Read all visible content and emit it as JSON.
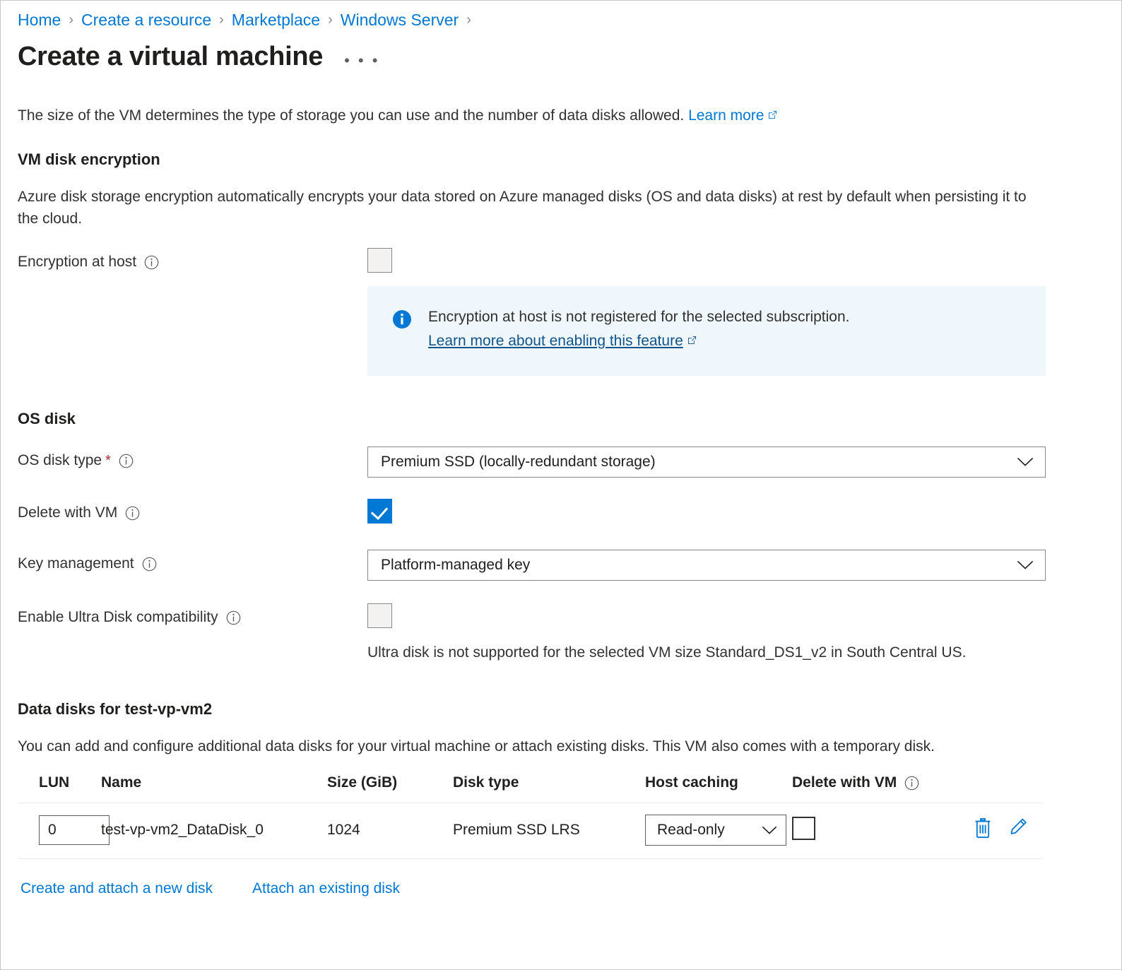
{
  "breadcrumb": {
    "items": [
      {
        "label": "Home"
      },
      {
        "label": "Create a resource"
      },
      {
        "label": "Marketplace"
      },
      {
        "label": "Windows Server"
      }
    ],
    "separator": "›"
  },
  "header": {
    "title": "Create a virtual machine",
    "more_label": "• • •"
  },
  "intro": {
    "text": "The size of the VM determines the type of storage you can use and the number of data disks allowed.",
    "link_label": "Learn more"
  },
  "vm_disk_encryption": {
    "heading": "VM disk encryption",
    "description": "Azure disk storage encryption automatically encrypts your data stored on Azure managed disks (OS and data disks) at rest by default when persisting it to the cloud.",
    "encryption_at_host": {
      "label": "Encryption at host",
      "checked": false
    },
    "banner": {
      "message": "Encryption at host is not registered for the selected subscription.",
      "link_label": "Learn more about enabling this feature",
      "background": "#eff6fc",
      "icon_color": "#0078d4"
    }
  },
  "os_disk": {
    "heading": "OS disk",
    "disk_type": {
      "label": "OS disk type",
      "required_marker": "*",
      "value": "Premium SSD (locally-redundant storage)"
    },
    "delete_with_vm": {
      "label": "Delete with VM",
      "checked": true
    },
    "key_management": {
      "label": "Key management",
      "value": "Platform-managed key"
    },
    "ultra_disk": {
      "label": "Enable Ultra Disk compatibility",
      "checked": false,
      "note": "Ultra disk is not supported for the selected VM size Standard_DS1_v2 in South Central US."
    }
  },
  "data_disks": {
    "heading": "Data disks for test-vp-vm2",
    "description": "You can add and configure additional data disks for your virtual machine or attach existing disks. This VM also comes with a temporary disk.",
    "columns": {
      "lun": "LUN",
      "name": "Name",
      "size": "Size (GiB)",
      "disk_type": "Disk type",
      "host_caching": "Host caching",
      "delete_with_vm": "Delete with VM"
    },
    "rows": [
      {
        "lun": "0",
        "name": "test-vp-vm2_DataDisk_0",
        "size": "1024",
        "disk_type": "Premium SSD LRS",
        "host_caching": "Read-only",
        "delete_with_vm": false
      }
    ],
    "actions": {
      "create_attach_label": "Create and attach a new disk",
      "attach_existing_label": "Attach an existing disk"
    }
  },
  "colors": {
    "accent": "#0078d4",
    "link": "#0078d4",
    "banner_link": "#0f548c",
    "required": "#a4262c",
    "text": "#323130"
  }
}
